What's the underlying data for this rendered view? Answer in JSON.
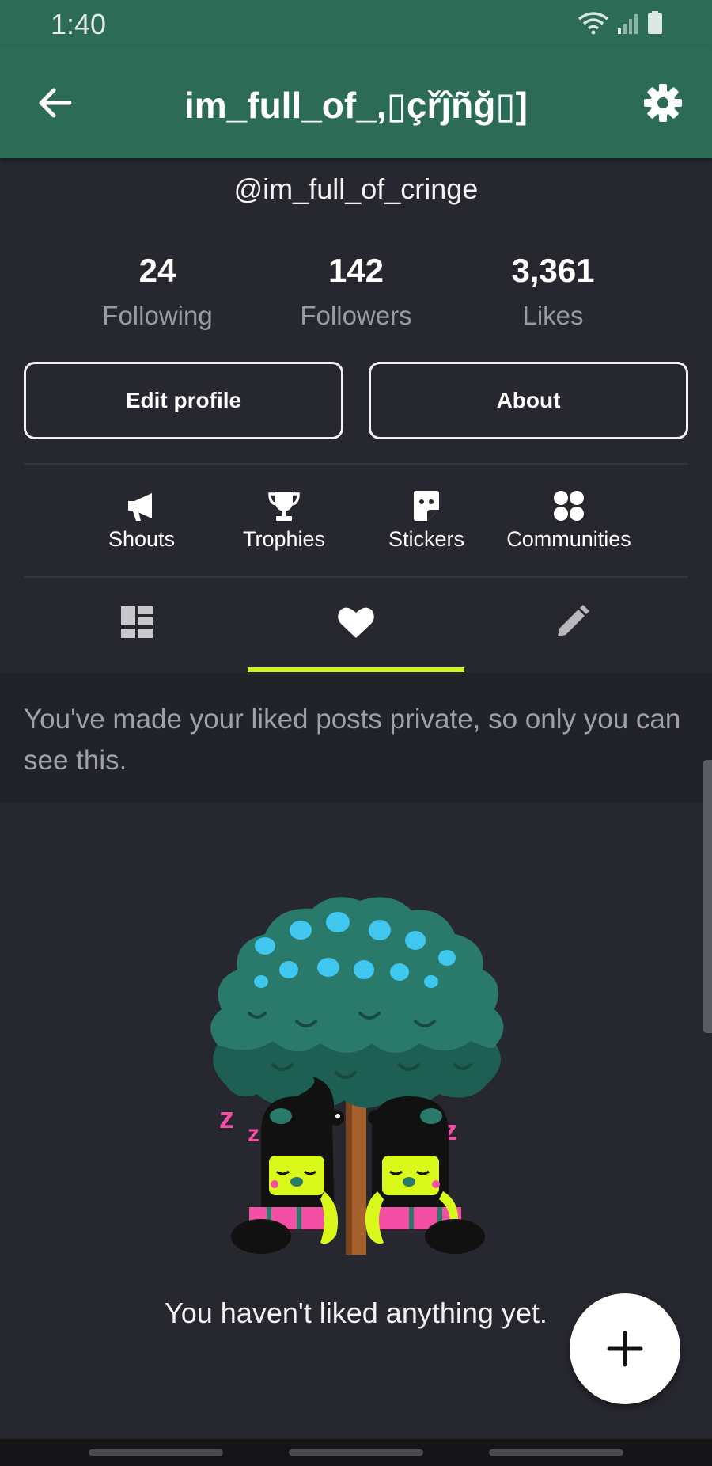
{
  "status": {
    "time": "1:40"
  },
  "header": {
    "title": "im_full_of_,▯çřĵñğ▯]"
  },
  "profile": {
    "handle": "@im_full_of_cringe"
  },
  "stats": [
    {
      "value": "24",
      "label": "Following"
    },
    {
      "value": "142",
      "label": "Followers"
    },
    {
      "value": "3,361",
      "label": "Likes"
    }
  ],
  "buttons": {
    "edit_profile": "Edit profile",
    "about": "About"
  },
  "shortcuts": [
    {
      "label": "Shouts",
      "icon": "megaphone-icon"
    },
    {
      "label": "Trophies",
      "icon": "trophy-icon"
    },
    {
      "label": "Stickers",
      "icon": "sticker-icon"
    },
    {
      "label": "Communities",
      "icon": "communities-icon"
    }
  ],
  "tabs": [
    {
      "icon": "posts-grid-icon",
      "active": false
    },
    {
      "icon": "heart-icon",
      "active": true
    },
    {
      "icon": "pencil-icon",
      "active": false
    }
  ],
  "notice": {
    "text": "You've made your liked posts private, so only you can see this."
  },
  "empty_state": {
    "text": "You haven't liked anything yet."
  },
  "colors": {
    "app_bar": "#2c6b55",
    "background": "#27272f",
    "tab_indicator": "#cdf516",
    "notice_bg": "#222229"
  }
}
